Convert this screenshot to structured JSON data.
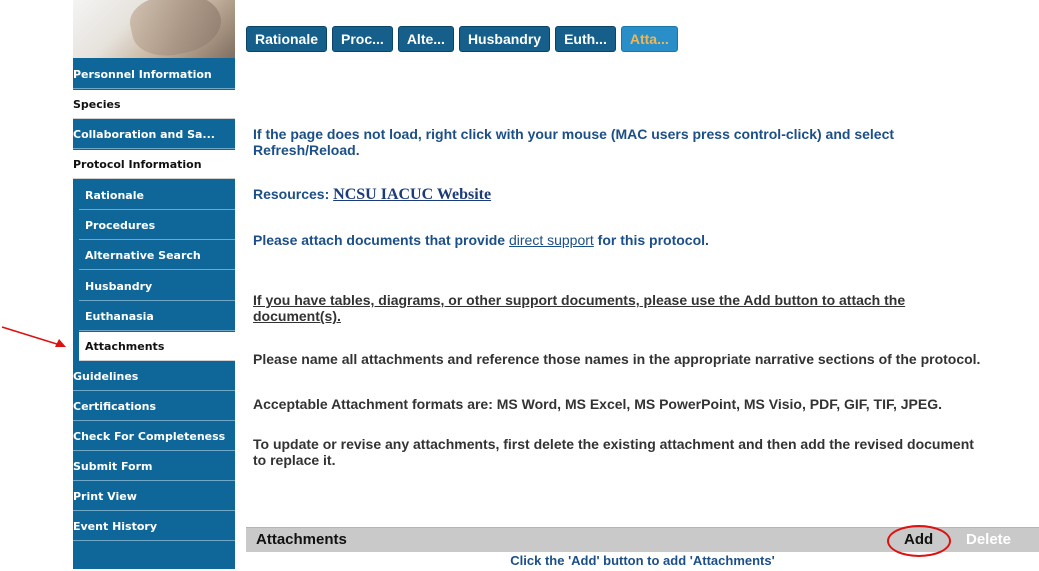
{
  "sidebar": {
    "items": [
      {
        "label": "Personnel Information"
      },
      {
        "label": "Species"
      },
      {
        "label": "Collaboration and Sa..."
      },
      {
        "label": "Protocol Information"
      },
      {
        "label": "Rationale"
      },
      {
        "label": "Procedures"
      },
      {
        "label": "Alternative Search"
      },
      {
        "label": "Husbandry"
      },
      {
        "label": "Euthanasia"
      },
      {
        "label": "Attachments"
      },
      {
        "label": "Guidelines"
      },
      {
        "label": "Certifications"
      },
      {
        "label": "Check For Completeness"
      },
      {
        "label": "Submit Form"
      },
      {
        "label": "Print View"
      },
      {
        "label": "Event History"
      }
    ]
  },
  "tabs": [
    {
      "label": "Rationale"
    },
    {
      "label": "Proc..."
    },
    {
      "label": "Alte..."
    },
    {
      "label": "Husbandry"
    },
    {
      "label": "Euth..."
    },
    {
      "label": "Atta..."
    }
  ],
  "content": {
    "reload_notice_line1": "If the page does not load, right click with your mouse (MAC users press control-click) and select",
    "reload_notice_line2": "Refresh/Reload.",
    "resources_prefix": "Resources: ",
    "resources_link": "NCSU IACUC Website",
    "attach_prefix": "Please attach documents that provide ",
    "attach_link": "direct support",
    "attach_suffix": " for this protocol.",
    "tables_line1": "If you have tables, diagrams, or other support documents, please use the Add button to attach the",
    "tables_line2": "document(s).",
    "name_notice": "Please name all attachments and reference those names in the appropriate narrative sections of the protocol.",
    "formats_notice": "Acceptable Attachment formats are: MS Word, MS Excel, MS PowerPoint, MS Visio, PDF, GIF, TIF, JPEG.",
    "update_line1": "To update or revise any attachments, first delete the existing attachment and then add the revised document",
    "update_line2": "to replace it."
  },
  "attachments_grid": {
    "title": "Attachments",
    "add_label": "Add",
    "delete_label": "Delete",
    "empty_message": "Click the 'Add' button to add 'Attachments'"
  },
  "colors": {
    "sidebar_bg": "#0e6699",
    "tab_bg": "#155f8a",
    "active_tab_text": "#f2b553",
    "text_blue": "#1c4f88",
    "annotation_red": "#dd1111"
  }
}
